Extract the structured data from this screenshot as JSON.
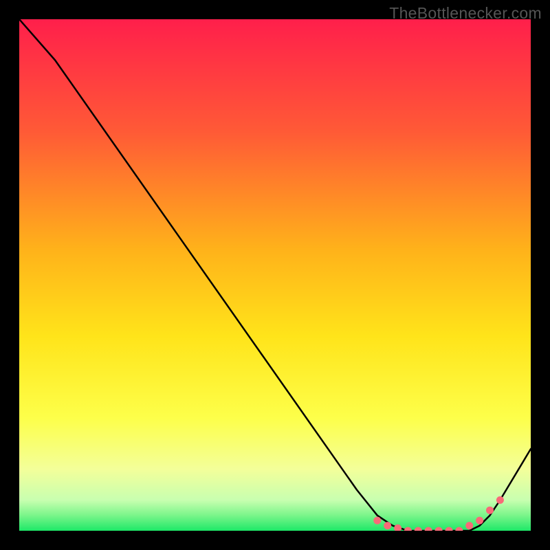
{
  "watermark": "TheBottlenecker.com",
  "colors": {
    "bg": "#000000",
    "grad_top": "#ff1f4b",
    "grad_mid_upper": "#ff7a2a",
    "grad_mid": "#ffd21a",
    "grad_lower": "#fff96a",
    "grad_bottom_pale": "#d6ffb0",
    "grad_bottom": "#1ee868",
    "line": "#000000",
    "marker": "#f86a78"
  },
  "chart_data": {
    "type": "line",
    "title": "",
    "xlabel": "",
    "ylabel": "",
    "xlim": [
      0,
      100
    ],
    "ylim": [
      0,
      100
    ],
    "series": [
      {
        "name": "bottleneck-curve",
        "x": [
          0,
          7,
          66,
          70,
          73,
          76,
          79,
          82,
          85,
          88,
          90,
          92,
          94,
          100
        ],
        "y": [
          100,
          92,
          8,
          3,
          1,
          0,
          0,
          0,
          0,
          0,
          1,
          3,
          6,
          16
        ]
      }
    ],
    "markers": {
      "name": "highlight-band",
      "x": [
        70,
        72,
        74,
        76,
        78,
        80,
        82,
        84,
        86,
        88,
        90,
        92,
        94
      ],
      "y": [
        2,
        1,
        0.5,
        0,
        0,
        0,
        0,
        0,
        0,
        1,
        2,
        4,
        6
      ]
    }
  }
}
